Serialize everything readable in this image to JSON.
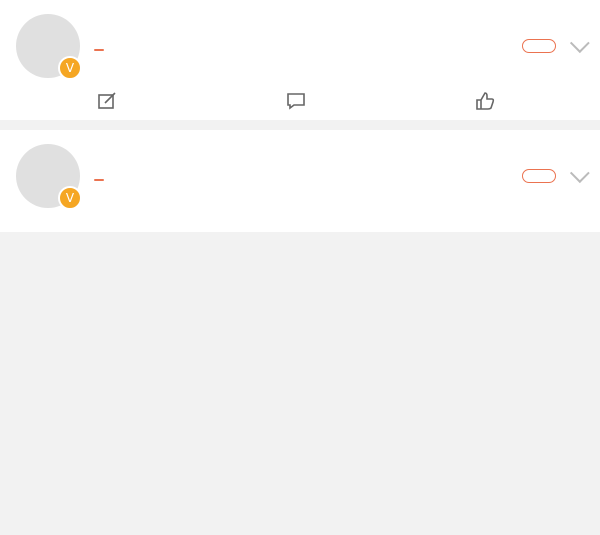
{
  "posts": [
    {
      "username": "",
      "tag": "",
      "time": "",
      "edited": "",
      "follow_label": "",
      "body": "",
      "repost_count": "",
      "comment_count": "",
      "like_count": ""
    },
    {
      "username": "",
      "tag": "",
      "time": "",
      "edited": "",
      "follow_label": "",
      "body": "",
      "repost_count": "",
      "comment_count": "",
      "like_count": ""
    }
  ],
  "icons": {
    "verified": "verified-badge-icon",
    "menu": "chevron-down-icon",
    "repost": "repost-icon",
    "comment": "comment-icon",
    "like": "thumbs-up-icon"
  },
  "colors": {
    "accent": "#eb7350",
    "background": "#f2f2f2",
    "card": "#ffffff",
    "text": "#333333",
    "muted": "#999999"
  }
}
